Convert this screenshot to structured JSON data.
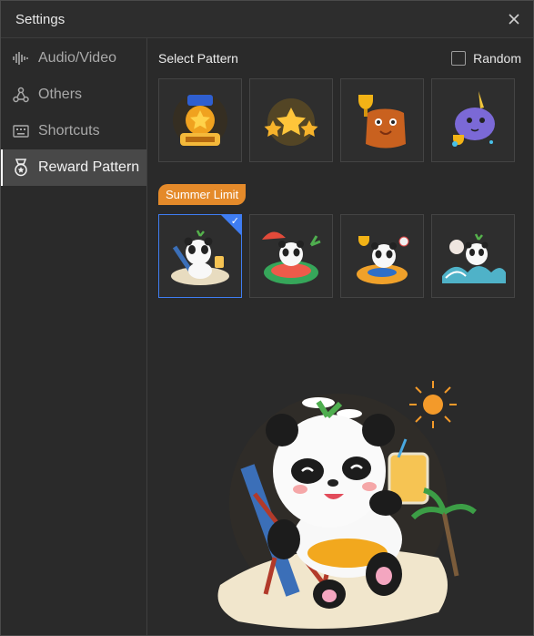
{
  "window": {
    "title": "Settings"
  },
  "sidebar": {
    "items": [
      {
        "label": "Audio/Video",
        "icon": "audio-wave-icon"
      },
      {
        "label": "Others",
        "icon": "share-nodes-icon"
      },
      {
        "label": "Shortcuts",
        "icon": "keyboard-icon"
      },
      {
        "label": "Reward Pattern",
        "icon": "medal-icon"
      }
    ]
  },
  "main": {
    "select_pattern": "Select Pattern",
    "random_label": "Random",
    "random_checked": false,
    "patterns": [
      {
        "name": "good-medal"
      },
      {
        "name": "three-stars"
      },
      {
        "name": "bear-trophy"
      },
      {
        "name": "narwhal-trophy"
      }
    ],
    "summer_tag": "Summer Limit",
    "summer_patterns": [
      {
        "name": "panda-beach-chair",
        "selected": true
      },
      {
        "name": "panda-watermelon-float",
        "selected": false
      },
      {
        "name": "panda-swim-ring",
        "selected": false
      },
      {
        "name": "panda-surfing",
        "selected": false
      }
    ]
  },
  "colors": {
    "accent": "#3f7df2",
    "tag": "#e48a2a"
  }
}
